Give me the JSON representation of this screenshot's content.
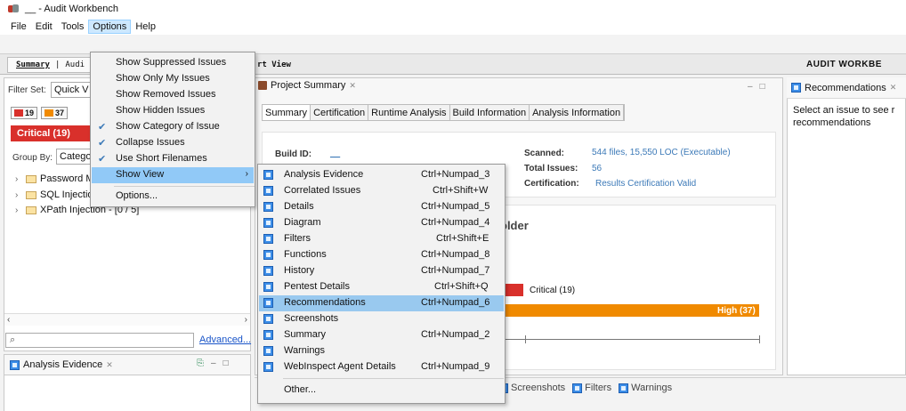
{
  "window": {
    "title": "__ - Audit Workbench"
  },
  "menubar": {
    "items": [
      "File",
      "Edit",
      "Tools",
      "Options",
      "Help"
    ],
    "active": "Options"
  },
  "perspective": {
    "tabs": [
      "Summary",
      "|",
      "Audi"
    ],
    "chart_view_label": "rt View",
    "workbench_label": "AUDIT WORKBE"
  },
  "left": {
    "filter_set_label": "Filter Set:",
    "filter_set_value": "Quick V",
    "counts": [
      {
        "value": "19",
        "color": "#d9302b"
      },
      {
        "value": "37",
        "color": "#f08a00"
      }
    ],
    "critical_tab": "Critical (19)",
    "group_by_label": "Group By:",
    "group_by_value": "Catego",
    "tree": [
      "Password M",
      "SQL Injectio",
      "XPath Injection - [0 / 5]"
    ],
    "search_placeholder": "⌕",
    "advanced_link": "Advanced...",
    "evidence_title": "Analysis Evidence",
    "evidence_close": "✕"
  },
  "center": {
    "tab_title": "Project Summary",
    "tab_close": "✕",
    "subtabs": [
      "Summary",
      "Certification",
      "Runtime Analysis",
      "Build Information",
      "Analysis Information"
    ],
    "build_id_label": "Build ID:",
    "build_id_value": "__",
    "partial_date": "",
    "scanned_label": "Scanned:",
    "scanned_value": "544 files, 15,550 LOC (Executable)",
    "total_issues_label": "Total Issues:",
    "total_issues_value": "56",
    "certification_label": "Certification:",
    "certification_value": "Results Certification Valid",
    "chart_heading": "older",
    "critical_label": "Critical (19)",
    "high_label": "High (37)",
    "bottom_tabs": [
      "Screenshots",
      "Filters",
      "Warnings"
    ]
  },
  "right": {
    "title": "Recommendations",
    "body": "Select an issue to see r recommendations"
  },
  "options_menu": {
    "items": [
      {
        "label": "Show Suppressed Issues",
        "checked": false
      },
      {
        "label": "Show Only My Issues",
        "checked": false
      },
      {
        "label": "Show Removed Issues",
        "checked": false
      },
      {
        "label": "Show Hidden Issues",
        "checked": false
      },
      {
        "label": "Show Category of Issue",
        "checked": true
      },
      {
        "label": "Collapse Issues",
        "checked": true
      },
      {
        "label": "Use Short Filenames",
        "checked": true
      },
      {
        "label": "Show View",
        "checked": false,
        "submenu": true,
        "highlighted": true
      },
      {
        "label": "Options...",
        "checked": false
      }
    ],
    "check_glyph": "✔",
    "submenu_arrow": "›"
  },
  "view_submenu": {
    "items": [
      {
        "label": "Analysis Evidence",
        "shortcut": "Ctrl+Numpad_3"
      },
      {
        "label": "Correlated Issues",
        "shortcut": "Ctrl+Shift+W"
      },
      {
        "label": "Details",
        "shortcut": "Ctrl+Numpad_5"
      },
      {
        "label": "Diagram",
        "shortcut": "Ctrl+Numpad_4"
      },
      {
        "label": "Filters",
        "shortcut": "Ctrl+Shift+E"
      },
      {
        "label": "Functions",
        "shortcut": "Ctrl+Numpad_8"
      },
      {
        "label": "History",
        "shortcut": "Ctrl+Numpad_7"
      },
      {
        "label": "Pentest Details",
        "shortcut": "Ctrl+Shift+Q"
      },
      {
        "label": "Recommendations",
        "shortcut": "Ctrl+Numpad_6",
        "highlighted": true
      },
      {
        "label": "Screenshots",
        "shortcut": ""
      },
      {
        "label": "Summary",
        "shortcut": "Ctrl+Numpad_2"
      },
      {
        "label": "Warnings",
        "shortcut": ""
      },
      {
        "label": "WebInspect Agent Details",
        "shortcut": "Ctrl+Numpad_9"
      },
      {
        "label": "Other...",
        "shortcut": ""
      }
    ]
  }
}
